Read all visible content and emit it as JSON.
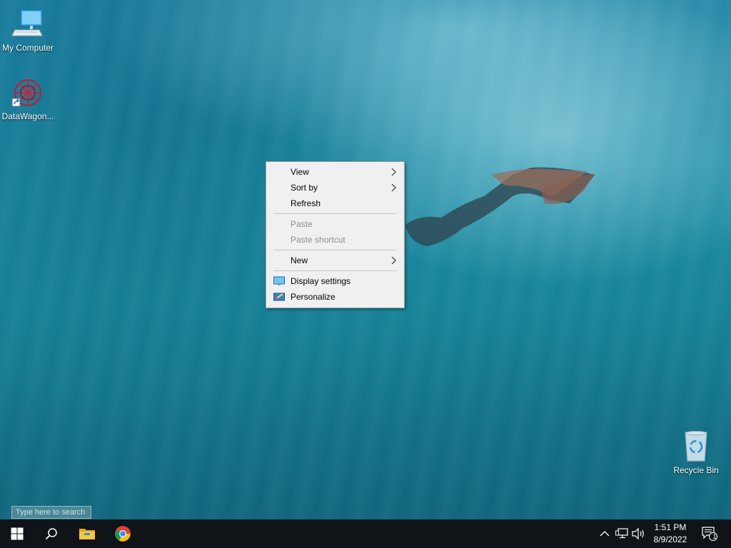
{
  "desktop": {
    "icons": [
      {
        "label": "My Computer",
        "icon": "computer-icon"
      },
      {
        "label": "DataWagon...",
        "icon": "datawagon-icon"
      },
      {
        "label": "Recycle Bin",
        "icon": "recycle-bin-icon"
      }
    ]
  },
  "context_menu": {
    "items": [
      {
        "label": "View",
        "submenu": true
      },
      {
        "label": "Sort by",
        "submenu": true
      },
      {
        "label": "Refresh"
      },
      {
        "label": "Paste",
        "disabled": true
      },
      {
        "label": "Paste shortcut",
        "disabled": true
      },
      {
        "label": "New",
        "submenu": true
      },
      {
        "label": "Display settings",
        "icon": "display-settings-icon"
      },
      {
        "label": "Personalize",
        "icon": "personalize-icon"
      }
    ]
  },
  "search": {
    "placeholder": "Type here to search"
  },
  "taskbar": {
    "pinned": [
      {
        "name": "Start",
        "icon": "windows-logo-icon"
      },
      {
        "name": "Search",
        "icon": "search-icon"
      },
      {
        "name": "File Explorer",
        "icon": "folder-icon"
      },
      {
        "name": "Google Chrome",
        "icon": "chrome-icon"
      }
    ],
    "tray": {
      "time": "1:51 PM",
      "date": "8/9/2022",
      "notification_count": "1"
    }
  },
  "colors": {
    "taskbar": "#101418",
    "menu_bg": "#f0f0f0",
    "disabled_text": "#8d8d8d"
  }
}
